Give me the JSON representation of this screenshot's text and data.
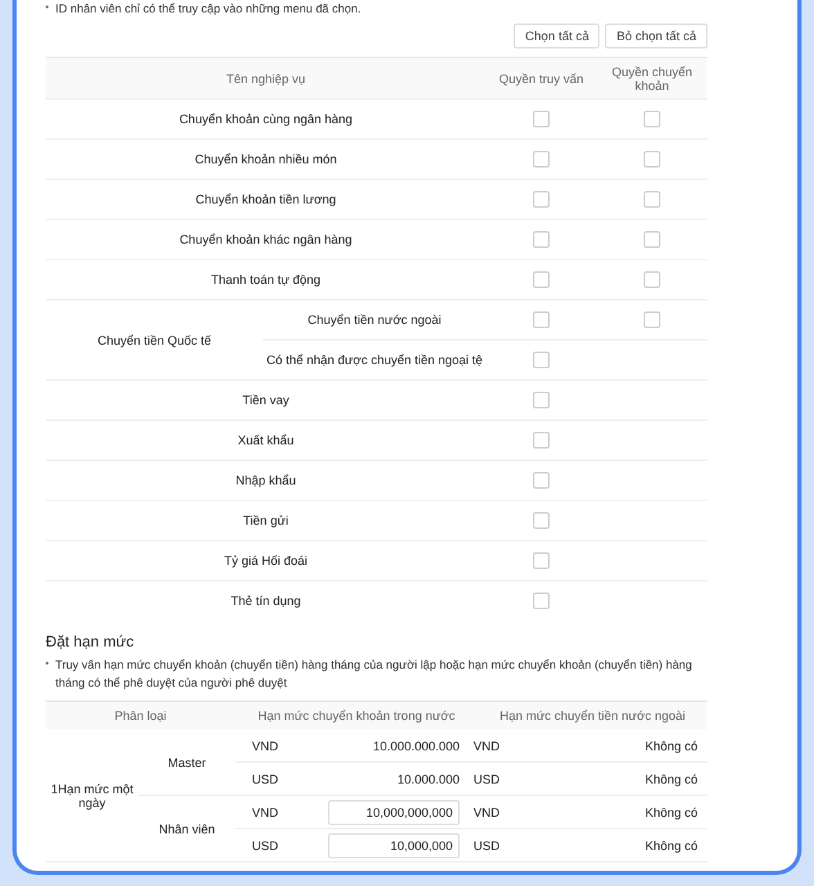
{
  "note": "ID nhân viên chỉ có thể truy cập vào những menu đã chọn.",
  "buttons": [
    {
      "label": "Chọn tất cả"
    },
    {
      "label": "Bỏ chọn tất cả"
    }
  ],
  "permission_table": {
    "columns": [
      "Tên nghiệp vụ",
      "Quyền truy vấn",
      "Quyền chuyển khoản"
    ],
    "rows": [
      {
        "kind": "single",
        "name": "Chuyển khoản cùng ngân hàng",
        "query": {
          "checked": false
        },
        "transfer": {
          "checked": false
        }
      },
      {
        "kind": "single",
        "name": "Chuyển khoản nhiều món",
        "query": {
          "checked": false
        },
        "transfer": {
          "checked": false
        }
      },
      {
        "kind": "single",
        "name": "Chuyển khoản tiền lương",
        "query": {
          "checked": false
        },
        "transfer": {
          "checked": false
        }
      },
      {
        "kind": "single",
        "name": "Chuyển khoản khác ngân hàng",
        "query": {
          "checked": false
        },
        "transfer": {
          "checked": false
        }
      },
      {
        "kind": "single",
        "name": "Thanh toán tự động",
        "query": {
          "checked": false
        },
        "transfer": {
          "checked": false
        }
      },
      {
        "kind": "group",
        "name": "Chuyển tiền Quốc tế",
        "children": [
          {
            "name": "Chuyển tiền nước ngoài",
            "query": {
              "checked": false
            },
            "transfer": {
              "checked": false
            }
          },
          {
            "name": "Có thể nhận được chuyển tiền ngoại tệ",
            "query": {
              "checked": false
            }
          }
        ]
      },
      {
        "kind": "single",
        "name": "Tiền vay",
        "query": {
          "checked": false
        }
      },
      {
        "kind": "single",
        "name": "Xuất khẩu",
        "query": {
          "checked": false
        }
      },
      {
        "kind": "single",
        "name": "Nhập khẩu",
        "query": {
          "checked": false
        }
      },
      {
        "kind": "single",
        "name": "Tiền gửi",
        "query": {
          "checked": false
        }
      },
      {
        "kind": "single",
        "name": "Tỷ giá Hối đoái",
        "query": {
          "checked": false
        }
      },
      {
        "kind": "single",
        "name": "Thẻ tín dụng",
        "query": {
          "checked": false
        }
      }
    ]
  },
  "limit_section": {
    "title": "Đặt hạn mức",
    "note": "Truy vấn hạn mức chuyển khoản (chuyển tiền) hàng tháng của người lập hoặc hạn mức chuyển khoản (chuyển tiền) hàng tháng có thể phê duyệt của người phê duyệt",
    "columns": [
      "Phân loại",
      "Hạn mức chuyển khoản trong nước",
      "Hạn mức chuyển tiền nước ngoài"
    ],
    "category": "1Hạn mức một ngày",
    "groups": [
      {
        "name": "Master",
        "rows": [
          {
            "currency": "VND",
            "domestic": {
              "kind": "text",
              "value": "10.000.000.000"
            },
            "foreign_currency": "VND",
            "foreign": "Không có"
          },
          {
            "currency": "USD",
            "domestic": {
              "kind": "text",
              "value": "10.000.000"
            },
            "foreign_currency": "USD",
            "foreign": "Không có"
          }
        ]
      },
      {
        "name": "Nhân viên",
        "rows": [
          {
            "currency": "VND",
            "domestic": {
              "kind": "input",
              "value": "10,000,000,000"
            },
            "foreign_currency": "VND",
            "foreign": "Không có"
          },
          {
            "currency": "USD",
            "domestic": {
              "kind": "input",
              "value": "10,000,000"
            },
            "foreign_currency": "USD",
            "foreign": "Không có"
          }
        ]
      }
    ]
  }
}
